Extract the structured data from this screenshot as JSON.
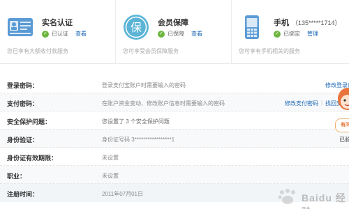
{
  "cards": [
    {
      "title": "实名认证",
      "status": "已认证",
      "link": "查看",
      "desc": "您已享有大额收付款服务",
      "icon": "id-card-icon"
    },
    {
      "title": "会员保障",
      "status": "已保障",
      "link": "查看",
      "desc": "您可享受会员保障服务",
      "icon": "shield-bao-icon",
      "icon_glyph": "保"
    },
    {
      "title": "手机",
      "phone": "（135*****1714）",
      "status": "已绑定",
      "link": "管理",
      "desc": "您可享有手机相关的服务",
      "icon": "mobile-phone-icon"
    }
  ],
  "rows": [
    {
      "label": "登录密码：",
      "value": "登录支付宝账户时需要输入的密码",
      "action": "修改登录密码"
    },
    {
      "label": "支付密码：",
      "value": "在账户资金变动、修改账户信息时需要输入的密码",
      "action": "修改支付密码",
      "action2": "找回支付密码"
    },
    {
      "label": "安全保护问题：",
      "value": "您设置了 3 个安全保护问题"
    },
    {
      "label": "身份验证：",
      "value": "身份证号码 3*****************1",
      "action": "已验"
    },
    {
      "label": "身份证有效期限：",
      "value": "未设置"
    },
    {
      "label": "职业：",
      "value": "未设置"
    },
    {
      "label": "注册时间：",
      "value": "2011年07月01日"
    }
  ],
  "mascot": {
    "bubble": "有问"
  },
  "watermark": {
    "text": "Baidu 经验",
    "icon": "baidu-paw-icon"
  },
  "colors": {
    "accent_link": "#1a66b3",
    "check_green": "#6cb640",
    "icon_blue": "#5b9bd5"
  }
}
